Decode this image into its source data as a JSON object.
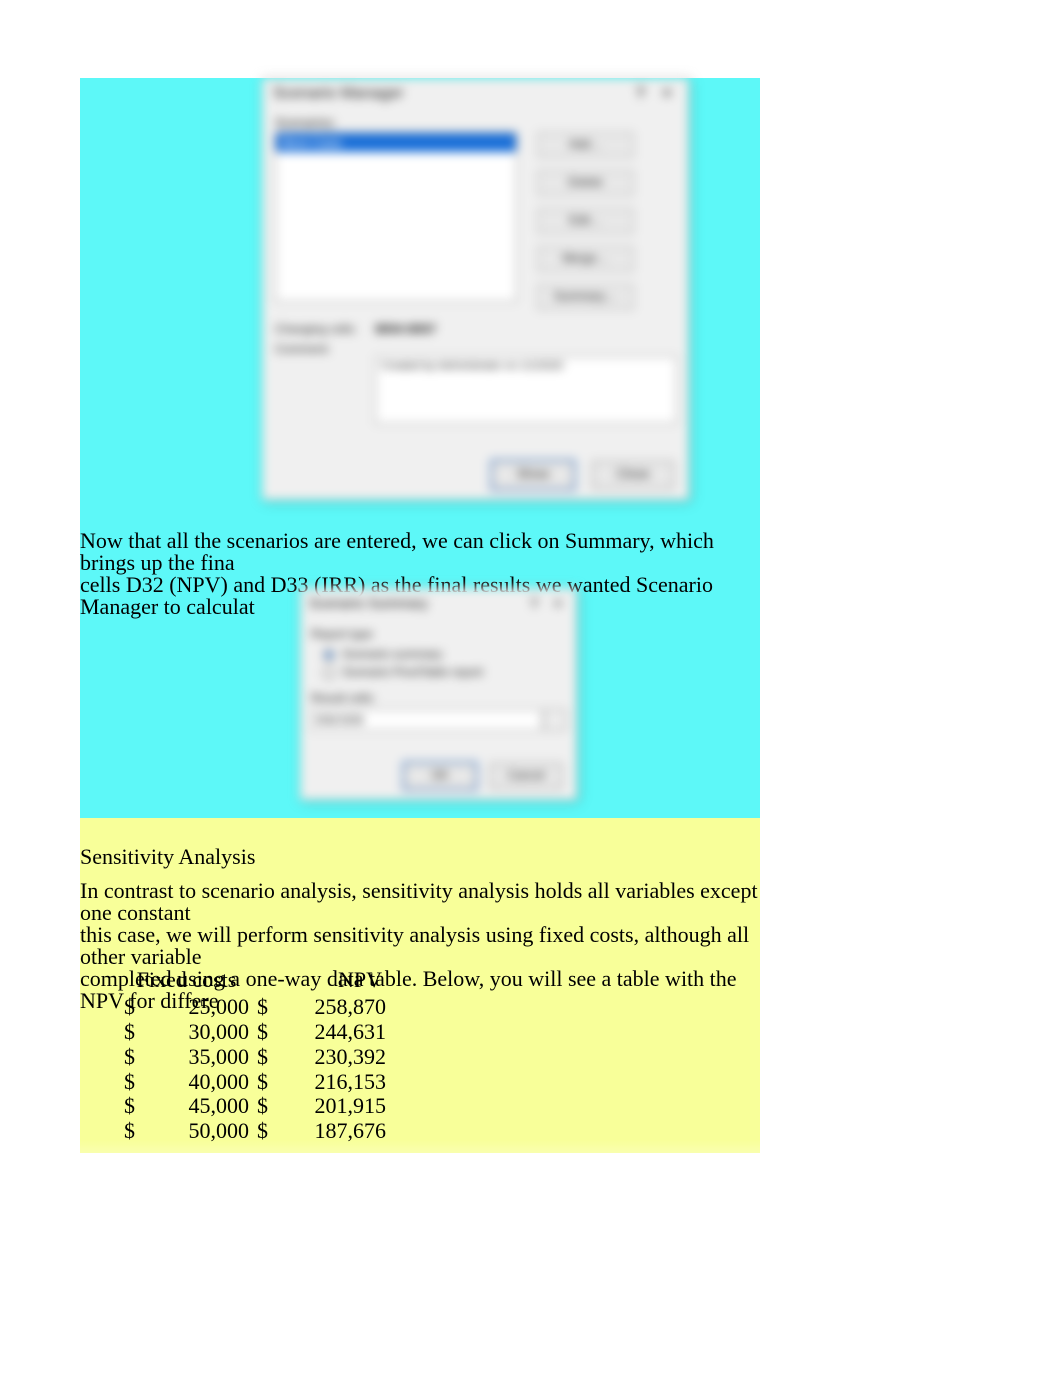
{
  "dlg1": {
    "title": "Scenario Manager",
    "scenarios_label": "Scenarios:",
    "selected_scenario": "Best Case",
    "btn_add": "Add…",
    "btn_delete": "Delete",
    "btn_edit": "Edit…",
    "btn_merge": "Merge…",
    "btn_summary": "Summary…",
    "changing_cells_label": "Changing cells:",
    "changing_cells_value": "$B$4:$B$7",
    "comment_label": "Comment:",
    "comment_value": "Created by Administrator on 1/1/2020",
    "btn_show": "Show",
    "btn_close": "Close"
  },
  "para_cyan_1": "Now that all the scenarios are entered, we can click on Summary, which brings up the fina",
  "para_cyan_2": "cells D32 (NPV) and D33 (IRR) as the final results we wanted Scenario Manager to calculat",
  "dlg2": {
    "title": "Scenario Summary",
    "report_type_label": "Report type",
    "opt_summary": "Scenario summary",
    "opt_pivot": "Scenario PivotTable report",
    "result_cells_label": "Result cells:",
    "result_cells_value": "D32:D33",
    "btn_ok": "OK",
    "btn_cancel": "Cancel"
  },
  "heading": "Sensitivity Analysis",
  "para_yellow_1": "In contrast to scenario analysis, sensitivity analysis holds all variables except one constant",
  "para_yellow_2": "this case, we will perform sensitivity analysis using fixed costs, although all other variable",
  "para_yellow_3": "completed using a one-way data table. Below, you will see a table with the NPV for differe",
  "table": {
    "header_fc": "Fixed costs",
    "header_npv": "NPV",
    "rows": [
      {
        "fc": "25,000",
        "npv": "258,870"
      },
      {
        "fc": "30,000",
        "npv": "244,631"
      },
      {
        "fc": "35,000",
        "npv": "230,392"
      },
      {
        "fc": "40,000",
        "npv": "216,153"
      },
      {
        "fc": "45,000",
        "npv": "201,915"
      },
      {
        "fc": "50,000",
        "npv": "187,676"
      }
    ]
  },
  "currency": "$"
}
